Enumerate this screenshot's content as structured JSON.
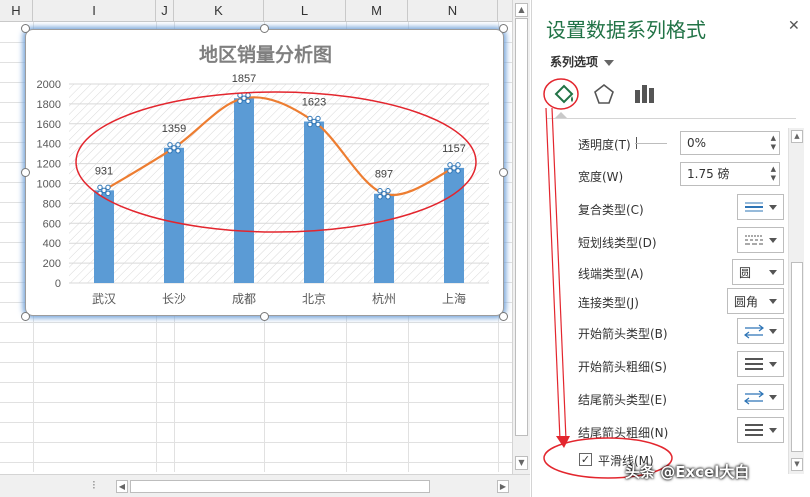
{
  "sheet": {
    "columns": [
      "H",
      "I",
      "J",
      "K",
      "L",
      "M",
      "N"
    ]
  },
  "chart_data": {
    "type": "bar",
    "title": "地区销量分析图",
    "categories": [
      "武汉",
      "长沙",
      "成都",
      "北京",
      "杭州",
      "上海"
    ],
    "values": [
      931,
      1359,
      1857,
      1623,
      897,
      1157
    ],
    "series": [
      {
        "name": "",
        "type": "bar",
        "values": [
          931,
          1359,
          1857,
          1623,
          897,
          1157
        ],
        "color": "#5b9bd5"
      },
      {
        "name": "",
        "type": "line",
        "smooth": true,
        "values": [
          931,
          1359,
          1857,
          1623,
          897,
          1157
        ],
        "color": "#ed7d31"
      }
    ],
    "data_labels": [
      "931",
      "1359",
      "1857",
      "1623",
      "897",
      "1157"
    ],
    "yticks": [
      "0",
      "200",
      "400",
      "600",
      "800",
      "1000",
      "1200",
      "1400",
      "1600",
      "1800",
      "2000"
    ],
    "ylim": [
      0,
      2000
    ],
    "grid": true,
    "legend": "none",
    "annotation": "red ellipse highlighting the smoothed line"
  },
  "pane": {
    "title": "设置数据系列格式",
    "series_options": "系列选项",
    "tabs": [
      "fill-line-icon",
      "effects-icon",
      "series-options-icon"
    ],
    "rows": {
      "transparency_label": "透明度(T)",
      "transparency_value": "0%",
      "width_label": "宽度(W)",
      "width_value": "1.75 磅",
      "compound_label": "复合类型(C)",
      "dash_label": "短划线类型(D)",
      "cap_label": "线端类型(A)",
      "cap_value": "圆",
      "join_label": "连接类型(J)",
      "join_value": "圆角",
      "begin_arrow_type_label": "开始箭头类型(B)",
      "begin_arrow_size_label": "开始箭头粗细(S)",
      "end_arrow_type_label": "结尾箭头类型(E)",
      "end_arrow_size_label": "结尾箭头粗细(N)",
      "smooth_label": "平滑线(M)",
      "smooth_checked": "✓"
    }
  },
  "watermark": "头条 @Excel大白",
  "colors": {
    "accent": "#217346",
    "bar": "#5b9bd5",
    "line": "#ed7d31",
    "annotation": "#e3262e"
  }
}
